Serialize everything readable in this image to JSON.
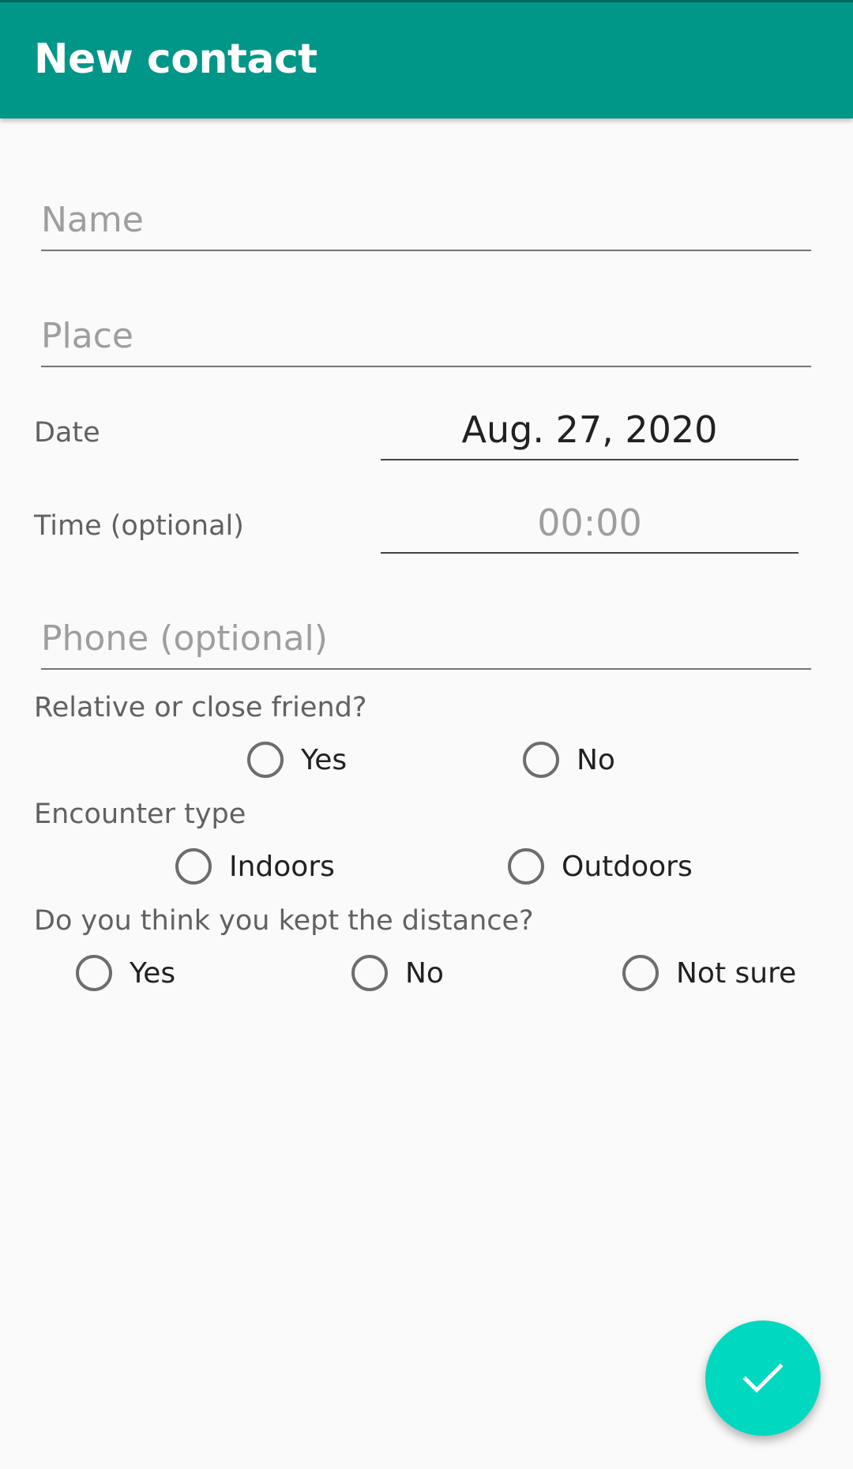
{
  "app_bar": {
    "title": "New contact",
    "color": "#009688"
  },
  "form": {
    "name": {
      "placeholder": "Name",
      "value": ""
    },
    "place": {
      "placeholder": "Place",
      "value": ""
    },
    "date": {
      "label": "Date",
      "value": "Aug. 27, 2020"
    },
    "time": {
      "label": "Time (optional)",
      "value": "00:00"
    },
    "phone": {
      "placeholder": "Phone (optional)",
      "value": ""
    },
    "relative": {
      "question": "Relative or close friend?",
      "options": [
        "Yes",
        "No"
      ],
      "selected": null
    },
    "encounter": {
      "question": "Encounter type",
      "options": [
        "Indoors",
        "Outdoors"
      ],
      "selected": null
    },
    "distance": {
      "question": "Do you think you kept the distance?",
      "options": [
        "Yes",
        "No",
        "Not sure"
      ],
      "selected": null
    }
  },
  "fab": {
    "icon": "check-icon",
    "color": "#00d8c0"
  }
}
